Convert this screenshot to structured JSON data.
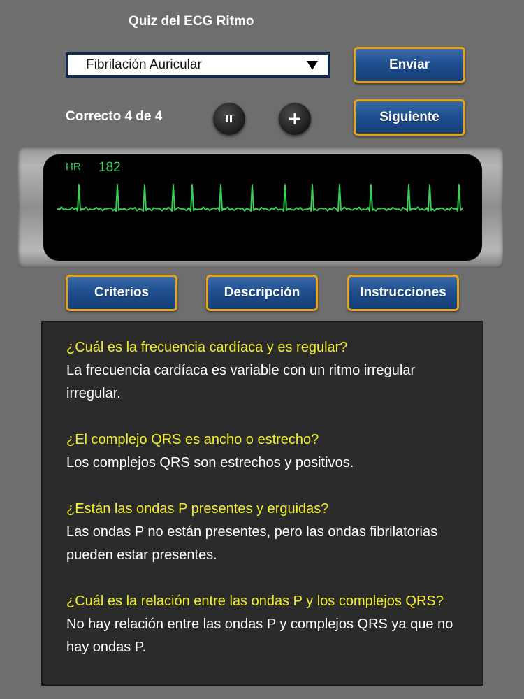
{
  "header": {
    "title": "Quiz del ECG Ritmo"
  },
  "answer_select": {
    "value": "Fibrilación Auricular"
  },
  "buttons": {
    "submit": "Enviar",
    "next": "Siguiente",
    "criteria": "Criterios",
    "description": "Descripción",
    "instructions": "Instrucciones"
  },
  "score": "Correcto 4 de 4",
  "controls": {
    "pause_icon": "pause-icon",
    "add_icon": "plus-icon"
  },
  "monitor": {
    "hr_label": "HR",
    "hr_value": "182"
  },
  "description": {
    "items": [
      {
        "question": "¿Cuál es la frecuencia cardíaca y es regular?",
        "answer": "La frecuencia cardíaca es variable con un ritmo irregular irregular."
      },
      {
        "question": "¿El complejo QRS es ancho o estrecho?",
        "answer": "Los complejos QRS son estrechos y positivos."
      },
      {
        "question": "¿Están las ondas P presentes y erguidas?",
        "answer": "Las ondas P no están presentes, pero las ondas fibrilatorias pueden estar presentes."
      },
      {
        "question": "¿Cuál es la relación entre las ondas P y los complejos QRS?",
        "answer": "No hay relación entre las ondas P y complejos QRS ya que no hay ondas P."
      }
    ]
  },
  "colors": {
    "background": "#6e6e6e",
    "button_blue": "#1f4f8f",
    "button_border": "#e6a316",
    "ecg_trace": "#39d05a",
    "question_text": "#f2ee2a"
  }
}
